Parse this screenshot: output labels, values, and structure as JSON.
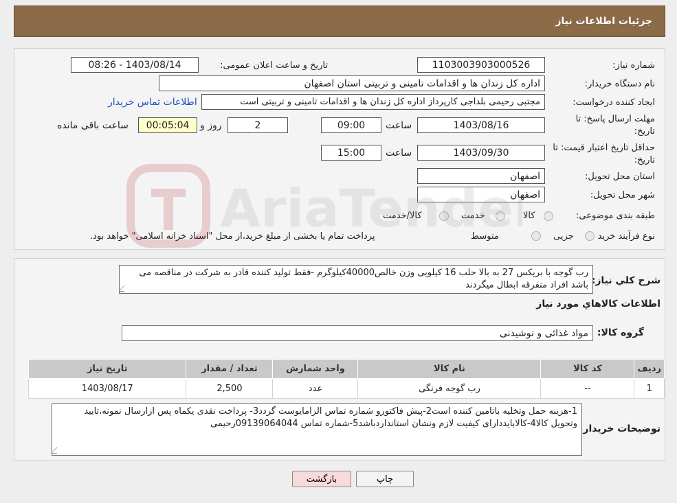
{
  "header": {
    "title": "جزئیات اطلاعات نیاز"
  },
  "form": {
    "need_number": {
      "label": "شماره نیاز:",
      "value": "1103003903000526"
    },
    "announce": {
      "label": "تاریخ و ساعت اعلان عمومی:",
      "value": "1403/08/14 - 08:26"
    },
    "buyer": {
      "label": "نام دستگاه خریدار:",
      "value": "اداره کل زندان ها و اقدامات تامینی و تربیتی استان اصفهان"
    },
    "creator": {
      "label": "ایجاد کننده درخواست:",
      "value": "مجتبی رحیمی بلداجی کارپرداز اداره کل زندان ها و اقدامات تامینی و تربیتی است",
      "contact_link": "اطلاعات تماس خریدار"
    },
    "deadline": {
      "label_line1": "مهلت ارسال پاسخ: تا",
      "label_line2": "تاریخ:",
      "date": "1403/08/16",
      "time_label": "ساعت",
      "time": "09:00",
      "days": "2",
      "days_label": "روز و",
      "remaining": "00:05:04",
      "remaining_label": "ساعت باقی مانده"
    },
    "validity": {
      "label_line1": "حداقل تاریخ اعتبار قیمت: تا",
      "label_line2": "تاریخ:",
      "date": "1403/09/30",
      "time_label": "ساعت",
      "time": "15:00"
    },
    "province": {
      "label": "استان محل تحویل:",
      "value": "اصفهان"
    },
    "city": {
      "label": "شهر محل تحویل:",
      "value": "اصفهان"
    },
    "category": {
      "label": "طبقه بندی موضوعی:",
      "options": [
        "کالا",
        "خدمت",
        "کالا/خدمت"
      ]
    },
    "process": {
      "label": "نوع فرآیند خرید :",
      "options": [
        "جزیی",
        "متوسط"
      ],
      "note": "پرداخت تمام یا بخشی از مبلغ خرید،از محل \"اسناد خزانه اسلامی\" خواهد بود."
    }
  },
  "watermark": {
    "text": "AriaTender.neT"
  },
  "description": {
    "label": "شرح کلي نياز:",
    "text": "رب گوجه  با بریکس 27 به بالا حلب 16 کیلویی وزن خالص40000کیلوگرم -فقط تولید کننده قادر به شرکت در مناقصه می باشد افراد متفرقه ابطال میگردند"
  },
  "goods": {
    "section_title": "اطلاعات کالاهاي مورد نياز",
    "group_label": "گروه کالا:",
    "group_value": "مواد غذائی و نوشیدنی",
    "columns": [
      "ردیف",
      "کد کالا",
      "نام کالا",
      "واحد شمارش",
      "تعداد / مقدار",
      "تاریخ نیاز"
    ],
    "rows": [
      [
        "1",
        "--",
        "رب گوجه فرنگی",
        "عدد",
        "2,500",
        "1403/08/17"
      ]
    ]
  },
  "buyer_notes": {
    "label": "توضیحات خریدار:",
    "text": "1-هزینه حمل وتخلیه باتامین کننده است2-پیش فاکتورو شماره تماس الزامایوست گردد3- پرداخت نقدی یکماه  پس ازارسال نمونه،تایید وتحویل کالا4-کالابایددارای کیفیت لازم ونشان استانداردباشد5-شماره تماس 09139064044رحیمی"
  },
  "buttons": {
    "print": "چاپ",
    "back": "بازگشت"
  },
  "colors": {
    "header_bg": "#8a6a47",
    "link": "#1a4fb8",
    "back_bg": "#f8d9dc"
  }
}
